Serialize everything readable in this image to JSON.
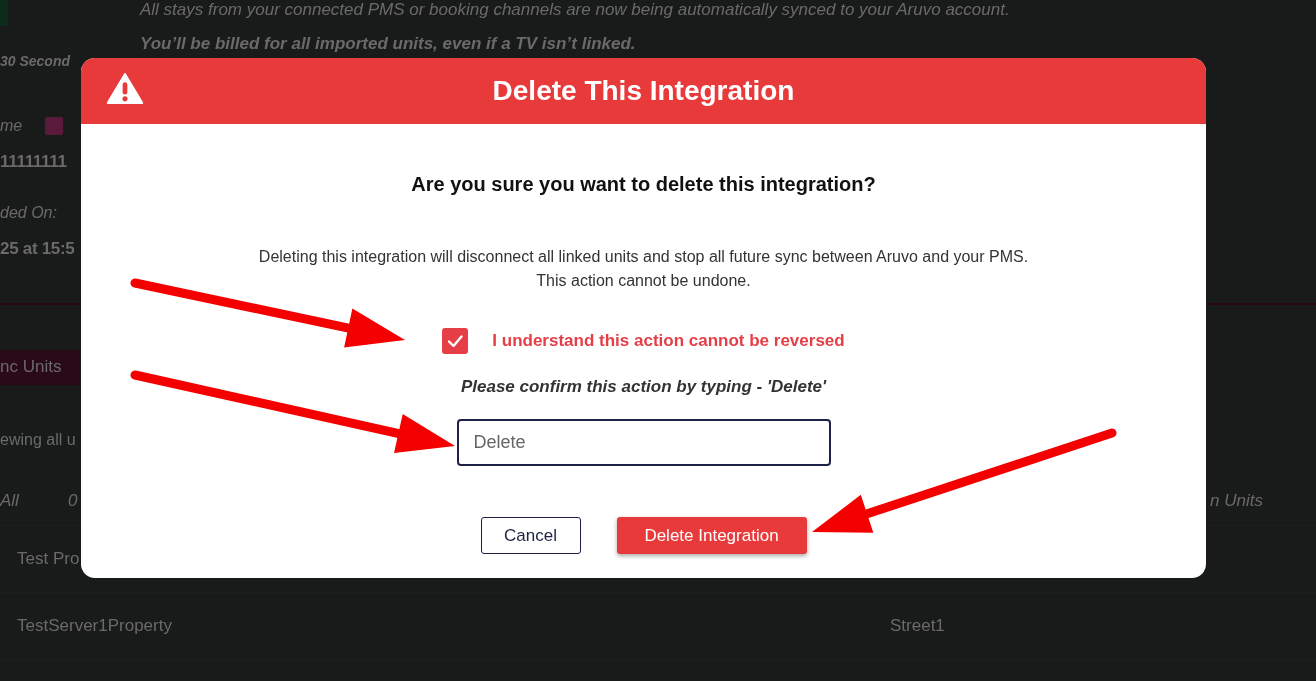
{
  "background": {
    "notice_lines": [
      "All stays from your connected PMS or booking channels are now being automatically synced to your Aruvo account.",
      "You’ll be billed for all imported units, even if a TV isn’t linked."
    ],
    "sidebar": {
      "timer": "30 Second",
      "name_label": "me",
      "name_value": "11111111",
      "added_label": "ded On:",
      "added_value": "25 at 15:5"
    },
    "sync_button": "nc Units",
    "viewing_text": "ewing all u",
    "table": {
      "header": {
        "column_1": "All",
        "column_2": "0",
        "column_3": "n Units"
      },
      "rows": [
        {
          "column_1": "Test Pro"
        },
        {
          "column_1": "TestServer1Property",
          "column_2": "Street1"
        }
      ]
    }
  },
  "dialog": {
    "title": "Delete This Integration",
    "question": "Are you sure you want to delete this integration?",
    "description_lines": [
      "Deleting this integration will disconnect all linked units and stop all future sync between Aruvo and your PMS.",
      "This action cannot be undone."
    ],
    "acknowledge": {
      "label": "I understand this action cannot be reversed",
      "checked": true
    },
    "confirm_prompt": "Please confirm this action by typing - 'Delete'",
    "confirm_field": {
      "value": "Delete"
    },
    "buttons": [
      {
        "label": "Cancel",
        "kind": "secondary"
      },
      {
        "label": "Delete Integration",
        "kind": "danger"
      }
    ]
  }
}
